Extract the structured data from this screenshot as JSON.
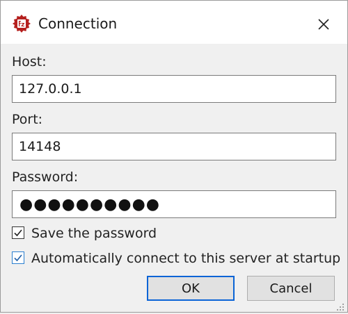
{
  "window": {
    "title": "Connection",
    "icon": "filezilla-icon",
    "close_icon": "close-icon"
  },
  "fields": {
    "host_label": "Host:",
    "host_value": "127.0.0.1",
    "port_label": "Port:",
    "port_value": "14148",
    "password_label": "Password:",
    "password_mask": "●●●●●●●●●●"
  },
  "options": {
    "save_password": {
      "label": "Save the password",
      "checked": true
    },
    "auto_connect": {
      "label": "Automatically connect to this server at startup",
      "checked": true
    }
  },
  "buttons": {
    "ok_label": "OK",
    "cancel_label": "Cancel"
  },
  "colors": {
    "accent": "#0a64d6",
    "icon_red": "#b5201e",
    "background": "#f0f0f0"
  }
}
